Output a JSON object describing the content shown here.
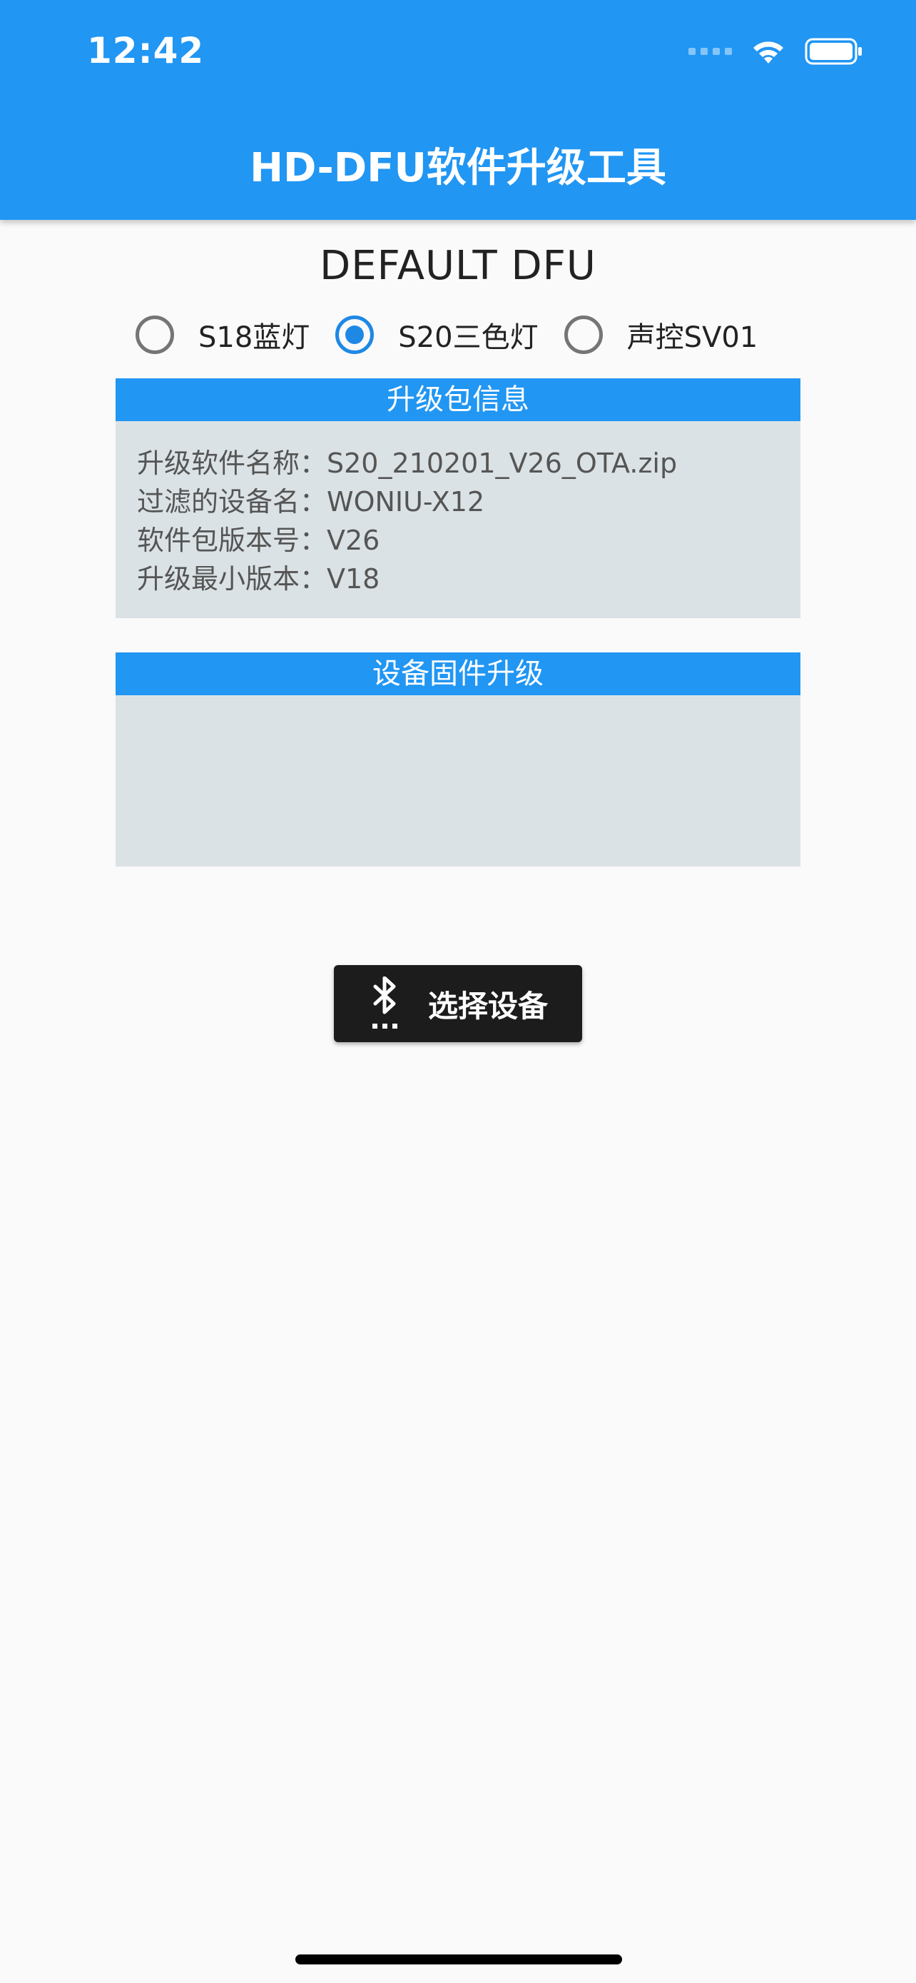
{
  "status_bar": {
    "time": "12:42",
    "icons": [
      "cellular-signal-icon",
      "wifi-icon",
      "battery-icon"
    ]
  },
  "header": {
    "title": "HD-DFU软件升级工具"
  },
  "main": {
    "mode_title": "DEFAULT DFU",
    "radio_options": [
      {
        "label": "S18蓝灯",
        "selected": false
      },
      {
        "label": "S20三色灯",
        "selected": true
      },
      {
        "label": "声控SV01",
        "selected": false
      }
    ],
    "package_info": {
      "header": "升级包信息",
      "lines": [
        "升级软件名称：S20_210201_V26_OTA.zip",
        "过滤的设备名：WONIU-X12",
        "软件包版本号：V26",
        "升级最小版本：V18"
      ]
    },
    "firmware_upgrade": {
      "header": "设备固件升级"
    },
    "select_device_button": {
      "label": "选择设备",
      "icon": "bluetooth-searching-icon"
    }
  },
  "colors": {
    "primary": "#2196f3",
    "radio_selected": "#1e88e5",
    "panel_bg": "#dbe2e5",
    "button_bg": "#1c1c1c",
    "background": "#fafafa"
  }
}
